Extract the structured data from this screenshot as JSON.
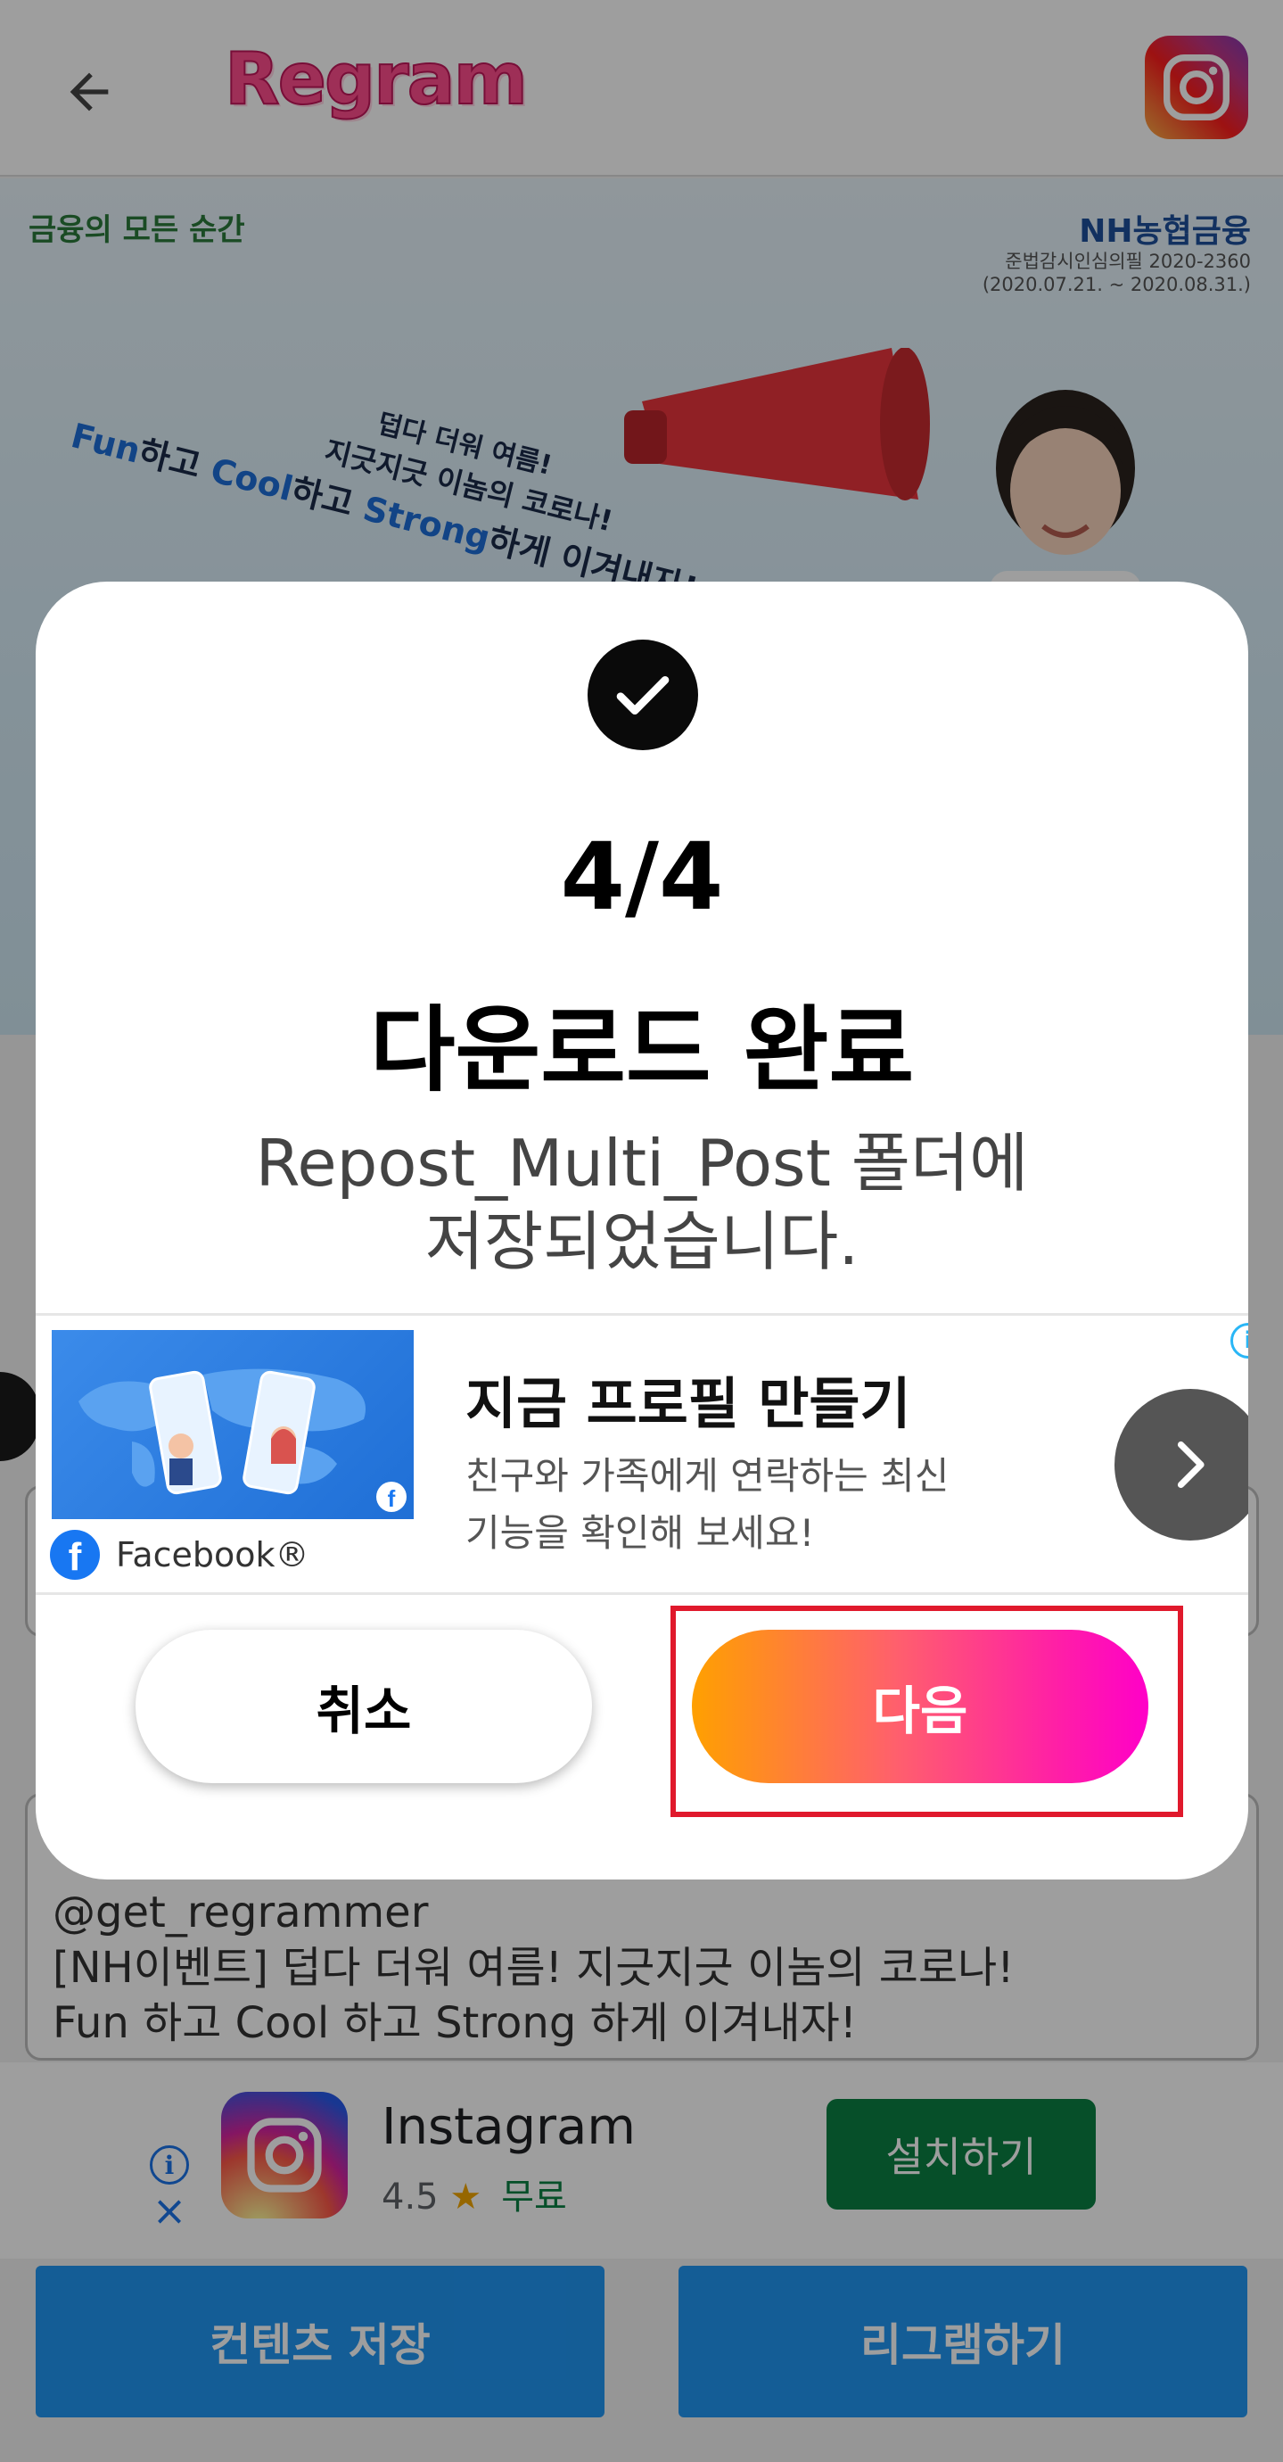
{
  "app_bar": {
    "title": "Regram",
    "back_icon": "arrow-left-icon",
    "instagram_icon": "instagram-icon"
  },
  "banner": {
    "brand_left": "금융의 모든 순간",
    "brand_right": "NH농협금융",
    "legal_line1": "준법감시인심의필 2020-2360",
    "legal_line2": "(2020.07.21. ~ 2020.08.31.)",
    "slogan_line1": "덥다 더워 여름!",
    "slogan_line2": "지긋지긋 이놈의 코로나!",
    "slogan_line3_fun": "Fun",
    "slogan_line3_a": "하고 ",
    "slogan_line3_cool": "Cool",
    "slogan_line3_b": "하고 ",
    "slogan_line3_strong": "Strong",
    "slogan_line3_c": "하게 이겨내자!"
  },
  "caption": {
    "lines": [
      "@get_regrammer",
      "[NH이벤트] 덥다 더워 여름! 지긋지긋 이놈의 코로나!",
      "Fun 하고 Cool 하고 Strong 하게 이겨내자!"
    ]
  },
  "dialog": {
    "count": "4/4",
    "title": "다운로드 완료",
    "message_line1": "Repost_Multi_Post 폴더에",
    "message_line2": "저장되었습니다.",
    "cancel_label": "취소",
    "next_label": "다음"
  },
  "dialog_ad": {
    "headline": "지금 프로필 만들기",
    "desc_line1": "친구와 가족에게 연락하는 최신",
    "desc_line2": "기능을 확인해 보세요!",
    "brand": "Facebook®",
    "choices_icon": "info-icon",
    "next_icon": "chevron-right-icon"
  },
  "bottom_ad": {
    "app_name": "Instagram",
    "rating": "4.5",
    "price": "무료",
    "install_label": "설치하기"
  },
  "bottom_buttons": {
    "save_label": "컨텐츠 저장",
    "regram_label": "리그램하기"
  },
  "colors": {
    "accent_pink": "#ff1fa6",
    "accent_orange": "#ffa000",
    "highlight_red": "#e0192c",
    "primary_blue": "#2196f3",
    "install_green": "#0b8043"
  }
}
